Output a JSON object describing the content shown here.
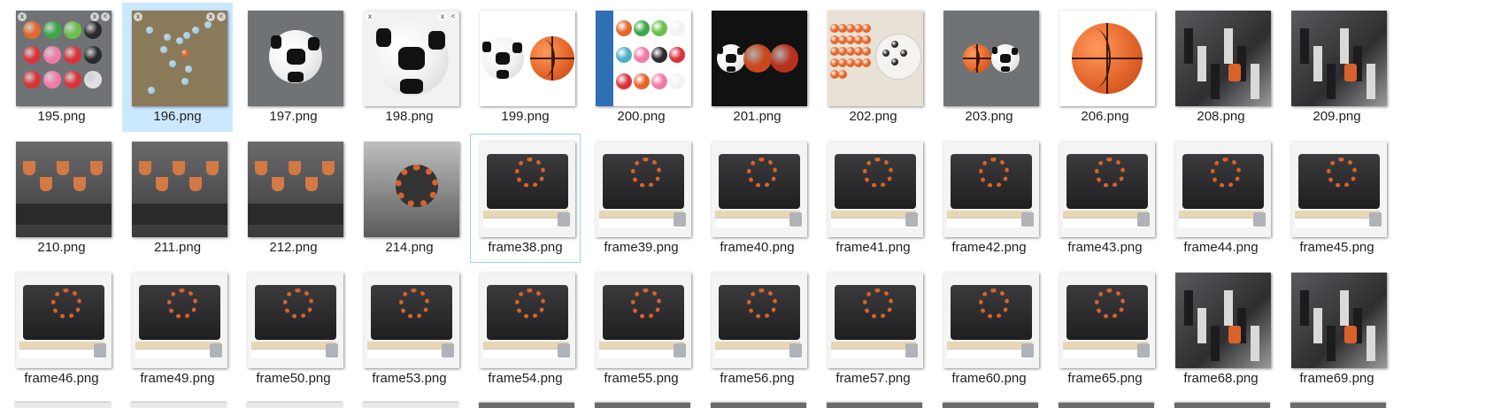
{
  "files": [
    {
      "name": "195.png",
      "thumb": "lego-balls-grid"
    },
    {
      "name": "196.png",
      "thumb": "scattered-balls",
      "selected": true
    },
    {
      "name": "197.png",
      "thumb": "soccer-ball-gray"
    },
    {
      "name": "198.png",
      "thumb": "soccer-ball-white"
    },
    {
      "name": "199.png",
      "thumb": "soccer-and-basketball"
    },
    {
      "name": "200.png",
      "thumb": "planet-gbc-balls"
    },
    {
      "name": "201.png",
      "thumb": "three-balls-dark"
    },
    {
      "name": "202.png",
      "thumb": "many-orange-balls"
    },
    {
      "name": "203.png",
      "thumb": "two-balls-gray"
    },
    {
      "name": "206.png",
      "thumb": "basketball"
    },
    {
      "name": "208.png",
      "thumb": "machine-side"
    },
    {
      "name": "209.png",
      "thumb": "machine-side"
    },
    {
      "name": "210.png",
      "thumb": "machine-closeup"
    },
    {
      "name": "211.png",
      "thumb": "machine-closeup"
    },
    {
      "name": "212.png",
      "thumb": "machine-closeup"
    },
    {
      "name": "214.png",
      "thumb": "machine-wheel"
    },
    {
      "name": "frame38.png",
      "thumb": "machine-front",
      "focused": true
    },
    {
      "name": "frame39.png",
      "thumb": "machine-front"
    },
    {
      "name": "frame40.png",
      "thumb": "machine-front"
    },
    {
      "name": "frame41.png",
      "thumb": "machine-front"
    },
    {
      "name": "frame42.png",
      "thumb": "machine-front"
    },
    {
      "name": "frame43.png",
      "thumb": "machine-front"
    },
    {
      "name": "frame44.png",
      "thumb": "machine-front"
    },
    {
      "name": "frame45.png",
      "thumb": "machine-front"
    },
    {
      "name": "frame46.png",
      "thumb": "machine-front"
    },
    {
      "name": "frame49.png",
      "thumb": "machine-front"
    },
    {
      "name": "frame50.png",
      "thumb": "machine-front"
    },
    {
      "name": "frame53.png",
      "thumb": "machine-front"
    },
    {
      "name": "frame54.png",
      "thumb": "machine-front"
    },
    {
      "name": "frame55.png",
      "thumb": "machine-front"
    },
    {
      "name": "frame56.png",
      "thumb": "machine-front"
    },
    {
      "name": "frame57.png",
      "thumb": "machine-front"
    },
    {
      "name": "frame60.png",
      "thumb": "machine-front"
    },
    {
      "name": "frame65.png",
      "thumb": "machine-front"
    },
    {
      "name": "frame68.png",
      "thumb": "machine-side"
    },
    {
      "name": "frame69.png",
      "thumb": "machine-side"
    }
  ],
  "overlay": {
    "close": "x",
    "share": "<"
  },
  "colors": {
    "selected_bg": "#cce8ff",
    "focus_border": "#99d1ff",
    "lego_gray": "#6f7376",
    "orange": "#e4662a",
    "machine_dark": "#2b2b2d"
  }
}
